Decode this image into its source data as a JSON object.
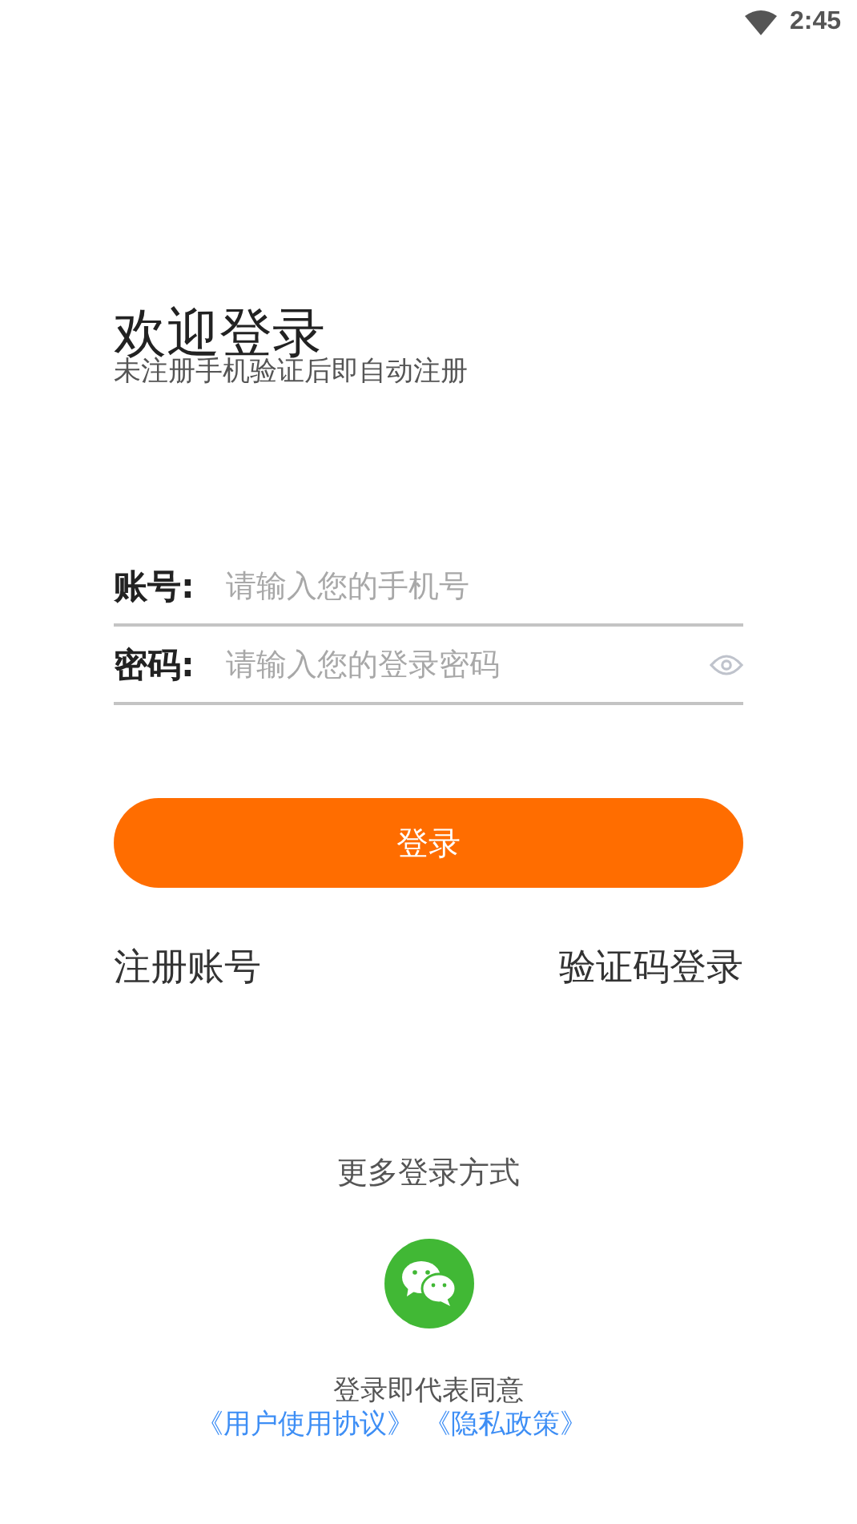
{
  "status_bar": {
    "time": "2:45"
  },
  "header": {
    "title": "欢迎登录",
    "subtitle": "未注册手机验证后即自动注册"
  },
  "fields": [
    {
      "kind": "text",
      "label": "账号:",
      "placeholder": "请输入您的手机号"
    },
    {
      "kind": "password",
      "label": "密码:",
      "placeholder": "请输入您的登录密码"
    }
  ],
  "login_button": "登录",
  "links": [
    "注册账号",
    "验证码登录"
  ],
  "other_login": {
    "label": "更多登录方式"
  },
  "agreement": {
    "text": "登录即代表同意",
    "links": [
      "《用户使用协议》",
      "《隐私政策》"
    ]
  }
}
